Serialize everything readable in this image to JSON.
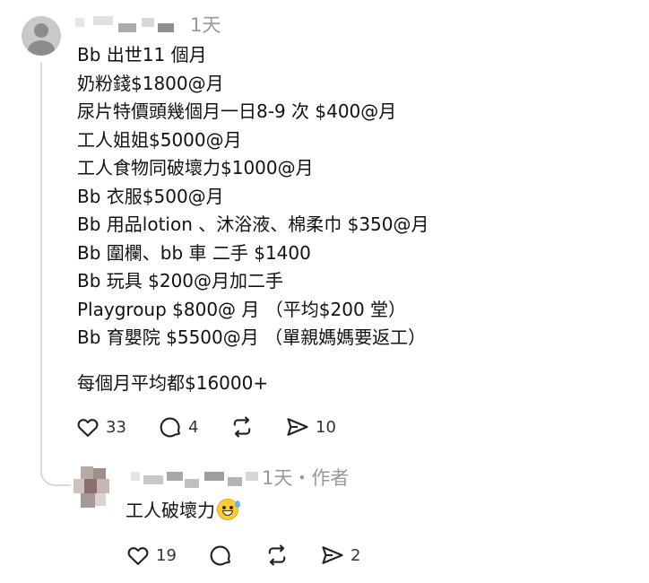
{
  "post": {
    "time": "1天",
    "lines": [
      "Bb 出世11 個月",
      "奶粉錢$1800@月",
      "尿片特價頭幾個月一日8-9 次 $400@月",
      "工人姐姐$5000@月",
      "工人食物同破壞力$1000@月",
      "Bb 衣服$500@月",
      "Bb 用品lotion 、沐浴液、棉柔巾 $350@月",
      "Bb 圍欄、bb 車 二手 $1400",
      "Bb 玩具 $200@月加二手",
      "Playgroup $800@ 月 （平均$200 堂）",
      "Bb 育嬰院 $5500@月 （單親媽媽要返工）"
    ],
    "summary": "每個月平均都$16000+",
    "actions": {
      "likes": "33",
      "comments": "4",
      "shares": "10"
    }
  },
  "reply": {
    "meta": "1天・作者",
    "text": "工人破壞力",
    "emoji": "sweat-smile",
    "actions": {
      "likes": "19",
      "shares": "2"
    }
  }
}
